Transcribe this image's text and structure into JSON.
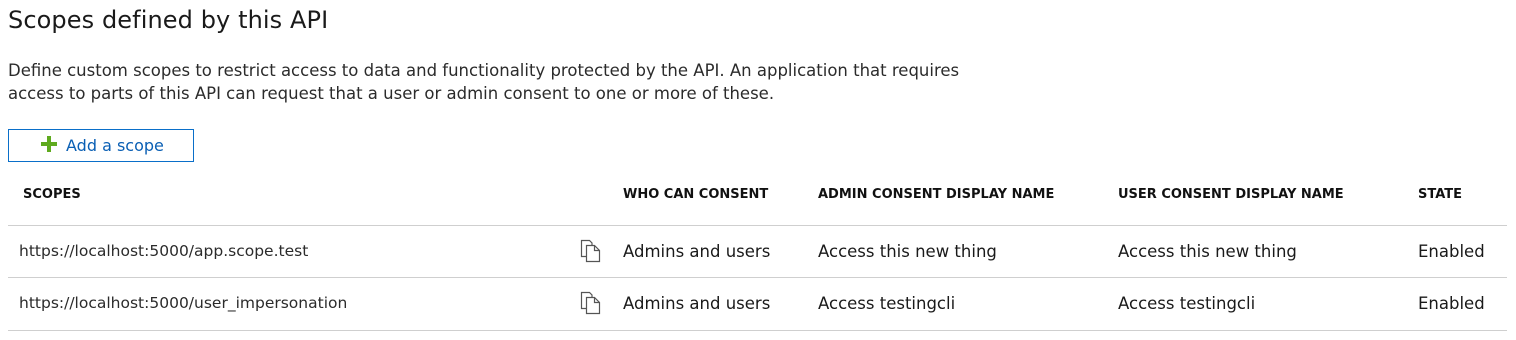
{
  "section": {
    "title": "Scopes defined by this API",
    "description": "Define custom scopes to restrict access to data and functionality protected by the API. An application that requires access to parts of this API can request that a user or admin consent to one or more of these."
  },
  "toolbar": {
    "add_scope_label": "Add a scope",
    "add_icon": "plus-icon",
    "add_icon_color": "#5faa1e",
    "accent_color": "#0a5fb4"
  },
  "table": {
    "columns": [
      "SCOPES",
      "WHO CAN CONSENT",
      "ADMIN CONSENT DISPLAY NAME",
      "USER CONSENT DISPLAY NAME",
      "STATE"
    ],
    "copy_icon": "copy-icon",
    "rows": [
      {
        "scope": "https://localhost:5000/app.scope.test",
        "who_can_consent": "Admins and users",
        "admin_consent_display_name": "Access this new thing",
        "user_consent_display_name": "Access this new thing",
        "state": "Enabled"
      },
      {
        "scope": "https://localhost:5000/user_impersonation",
        "who_can_consent": "Admins and users",
        "admin_consent_display_name": "Access testingcli",
        "user_consent_display_name": "Access testingcli",
        "state": "Enabled"
      }
    ]
  }
}
